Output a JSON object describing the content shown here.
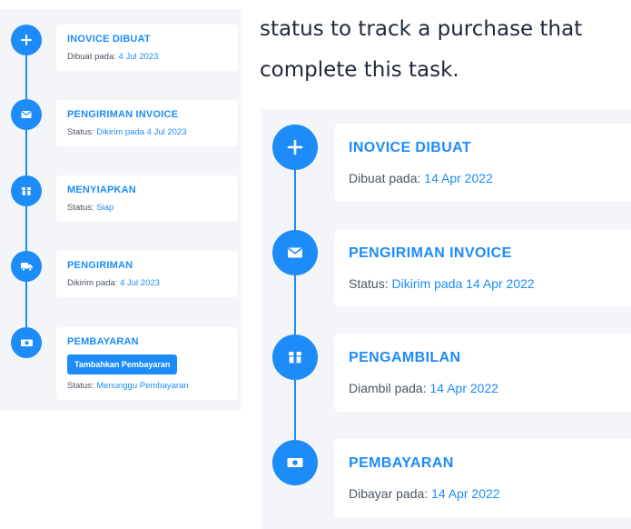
{
  "accent_color": "#1d8cf8",
  "left_timeline": {
    "steps": [
      {
        "icon": "plus-icon",
        "title": "INOVICE DIBUAT",
        "label": "Dibuat pada:",
        "value": "4 Jul 2023"
      },
      {
        "icon": "envelope-icon",
        "title": "PENGIRIMAN INVOICE",
        "label": "Status:",
        "value": "Dikirim pada 4 Jul 2023"
      },
      {
        "icon": "package-icon",
        "title": "MENYIAPKAN",
        "label": "Status:",
        "value": "Siap"
      },
      {
        "icon": "truck-icon",
        "title": "PENGIRIMAN",
        "label": "Dikirim pada:",
        "value": "4 Jul 2023"
      },
      {
        "icon": "money-icon",
        "title": "PEMBAYARAN",
        "button": "Tambahkan Pembayaran",
        "label": "Status:",
        "value": "Menunggu Pembayaran"
      }
    ]
  },
  "document": {
    "line1": "status to track a purchase that",
    "line2": "complete this task."
  },
  "right_timeline": {
    "steps": [
      {
        "icon": "plus-icon",
        "title": "INOVICE DIBUAT",
        "label": "Dibuat pada:",
        "value": "14 Apr 2022"
      },
      {
        "icon": "envelope-icon",
        "title": "PENGIRIMAN INVOICE",
        "label": "Status:",
        "value": "Dikirim pada 14 Apr 2022"
      },
      {
        "icon": "package-icon",
        "title": "PENGAMBILAN",
        "label": "Diambil pada:",
        "value": "14 Apr 2022"
      },
      {
        "icon": "money-icon",
        "title": "PEMBAYARAN",
        "label": "Dibayar pada:",
        "value": "14 Apr 2022"
      }
    ]
  }
}
